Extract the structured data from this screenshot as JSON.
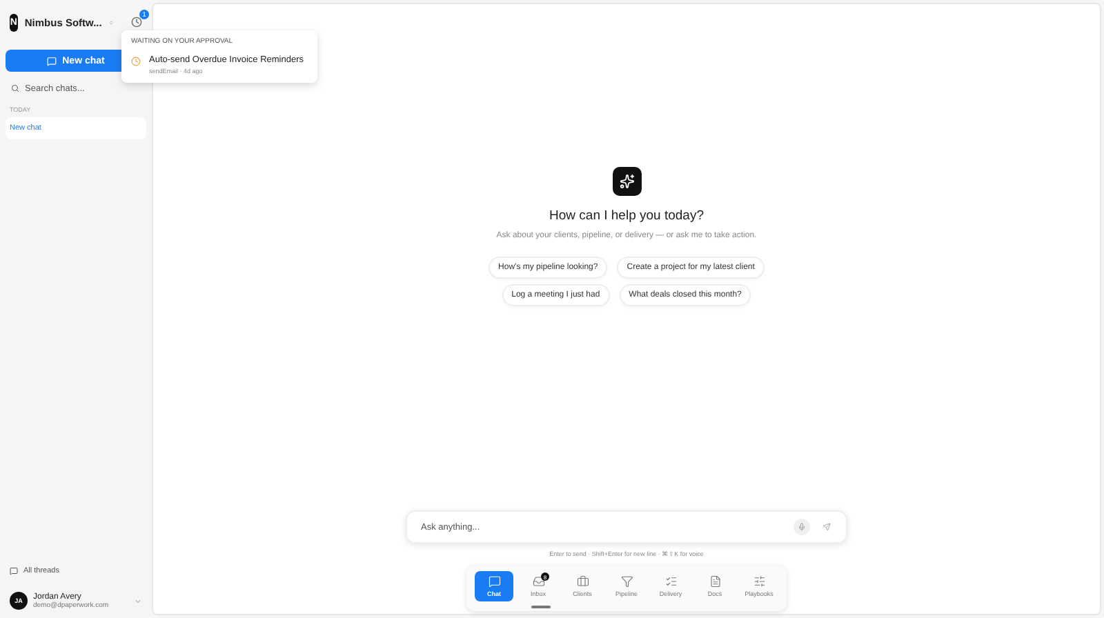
{
  "workspace": {
    "initial": "N",
    "name": "Nimbus Softw...",
    "notification_count": "1"
  },
  "approval_popover": {
    "heading": "WAITING ON YOUR APPROVAL",
    "items": [
      {
        "title": "Auto-send Overdue Invoice Reminders",
        "meta": "sendEmail · 4d ago"
      }
    ]
  },
  "sidebar": {
    "new_chat": "New chat",
    "search": {
      "placeholder": "Search chats..."
    },
    "groups": [
      {
        "label": "TODAY",
        "items": [
          {
            "label": "New chat",
            "selected": true
          }
        ]
      }
    ],
    "all_threads": "All threads",
    "user": {
      "initials": "JA",
      "name": "Jordan Avery",
      "email": "demo@dpaperwork.com"
    }
  },
  "welcome": {
    "title": "How can I help you today?",
    "subtitle": "Ask about your clients, pipeline, or delivery — or ask me to take action.",
    "suggestions": [
      [
        "How's my pipeline looking?",
        "Create a project for my latest client"
      ],
      [
        "Log a meeting I just had",
        "What deals closed this month?"
      ]
    ]
  },
  "composer": {
    "placeholder": "Ask anything...",
    "hint": "Enter to send · Shift+Enter for new line · ⌘⇧K for voice"
  },
  "nav": [
    {
      "kind": "chat",
      "label": "Chat",
      "selected": true
    },
    {
      "kind": "inbox",
      "label": "Inbox",
      "selected": false,
      "badge": "8"
    },
    {
      "kind": "clients",
      "label": "Clients",
      "selected": false
    },
    {
      "kind": "pipeline",
      "label": "Pipeline",
      "selected": false
    },
    {
      "kind": "delivery",
      "label": "Delivery",
      "selected": false
    },
    {
      "kind": "docs",
      "label": "Docs",
      "selected": false
    },
    {
      "kind": "playbooks",
      "label": "Playbooks",
      "selected": false
    }
  ]
}
